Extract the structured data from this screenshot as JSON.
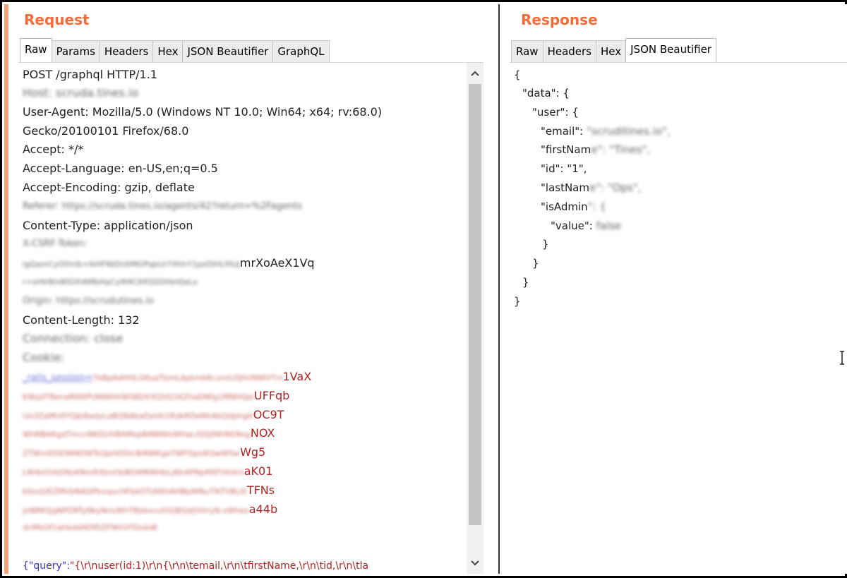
{
  "request": {
    "title": "Request",
    "tabs": [
      "Raw",
      "Params",
      "Headers",
      "Hex",
      "JSON Beautifier",
      "GraphQL"
    ],
    "lines": {
      "l1": "POST /graphql HTTP/1.1",
      "l2": "Host: scruda.tines.io",
      "l3": "User-Agent: Mozilla/5.0 (Windows NT 10.0; Win64; x64; rv:68.0)",
      "l4": "Gecko/20100101 Firefox/68.0",
      "l5": "Accept: */*",
      "l6": "Accept-Language: en-US,en;q=0.5",
      "l7": "Accept-Encoding: gzip, deflate",
      "l8": "Referer: https://scruda.tines.io/agents/42?return=%2Fagents",
      "l9": "Content-Type: application/json",
      "l10": "X-CSRF-Token:",
      "l11a": "lgQamCyOOnlb+IkHFNtDUIlMGPqbUrYXhhY1peDlHLfIIUJ",
      "l11b": "mrXoAeX1Vq",
      "l12": "r+eHkWsWlDXIAMbHpCy9tKCKKSDDHeVJaLu",
      "l13": "Origin: https://scrudutines.io",
      "l14": "Content-Length: 132",
      "l15": "Connection: close",
      "l16": "Cookie:",
      "l17a": "_rails_session=",
      "l17b": "TkBpAdHHLGKuaTbmLAykmbKcvnrLlQhUNWVTnl",
      "l17c": "1VaX",
      "l18a": "K9bjdTRenaMXKPUNWHVWSBDXXQVQ1KZhaDNfg1MNHQpl",
      "l18b": "UFFqb",
      "l19a": "Uo3ZaMU0YQjbRadyLaBQNAbaDaVk1RdkRDeNhAbQdphgH",
      "l19b": "OC9T",
      "l20a": "WhRBAKgdTmcnNKDUVBAMspBiNNWsWHaLiQQjINhRENxg",
      "l20b": "NOX",
      "l21a": "ZTWmDDDWNDWTsQpHtDVcBlRWKgeTWFQpoKQwWSw",
      "l21b": "Wg5",
      "l22a": "L8HbGVbDNsKNmRXbnObBDWRWHbLjNhAPNpRNTHhIkV",
      "l22b": "aK01",
      "l23a": "bSsrjUEZMVbNADPbvqucHFbkDTzKKhAHBpWNuTNTVBLl0",
      "l23b": "TFNs",
      "l24a": "jnNRKQgNPDRTyNkyNnsWhTBbbvvvOVjBQdjSHnyN-xWhes",
      "l24b": "a44b",
      "l25": "dcMbOf1ahbdd4DfDZFNH1FEbdoB",
      "query_key": "{\"query\":",
      "query_val": "\"{\\r\\nuser(id:1)\\r\\n{\\r\\n\\temail,\\r\\n\\tfirstName,\\r\\n\\tid,\\r\\n\\tla"
    }
  },
  "response": {
    "title": "Response",
    "tabs": [
      "Raw",
      "Headers",
      "Hex",
      "JSON Beautifier"
    ],
    "lines": {
      "j1": "{",
      "j2": "\"data\": {",
      "j3": "\"user\": {",
      "j4a": "\"email\": ",
      "j4b": "\"scruditines.io\",",
      "j5a": "\"firstNam",
      "j5b": "e\": \"Tines\",",
      "j6": "\"id\": \"1\",",
      "j7a": "\"lastNam",
      "j7b": "e\": \"Ops\",",
      "j8a": "\"isAdmin",
      "j8b": "\": {",
      "j9a": "\"value\": ",
      "j9b": "false",
      "j10": "}",
      "j11": "}",
      "j12": "}",
      "j13": "}"
    }
  },
  "colors": {
    "accent": "#f26b3a",
    "pane_border": "#f3a37c",
    "cookie_red": "#b22222",
    "key_blue": "#3333cc"
  },
  "icons": {
    "scroll_up": "chevron-up-icon",
    "scroll_down": "chevron-down-icon",
    "cursor": "text-cursor-icon"
  }
}
